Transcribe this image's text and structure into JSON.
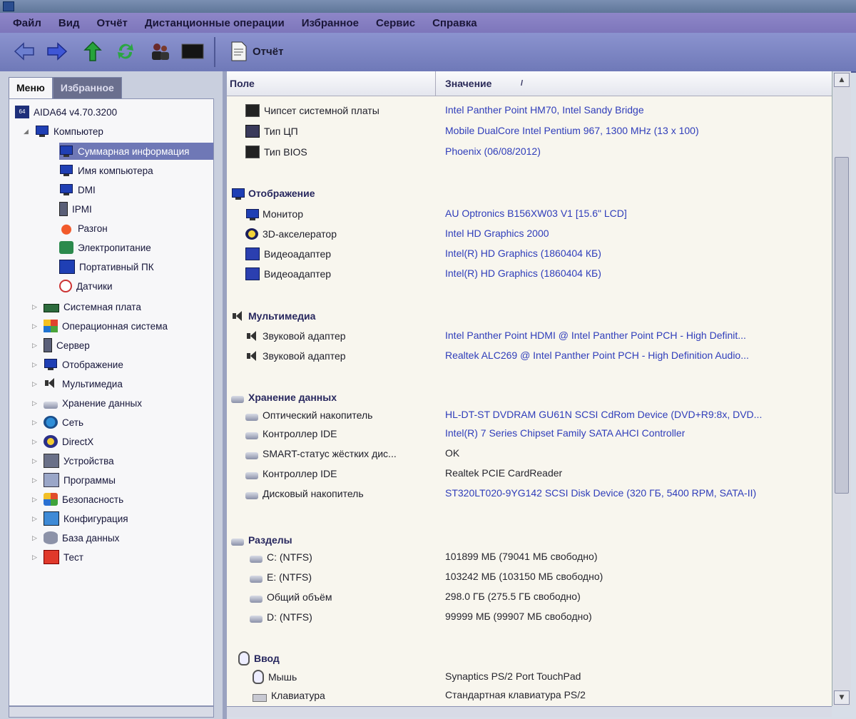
{
  "menu": [
    "Файл",
    "Вид",
    "Отчёт",
    "Дистанционные операции",
    "Избранное",
    "Сервис",
    "Справка"
  ],
  "toolbar": {
    "back_icon": "arrow-left-icon",
    "forward_icon": "arrow-right-icon",
    "up_icon": "arrow-up-icon",
    "refresh_icon": "refresh-icon",
    "users_icon": "users-icon",
    "report_label": "Отчёт"
  },
  "left_panel": {
    "tabs": [
      "Меню",
      "Избранное"
    ],
    "root": "AIDA64 v4.70.3200",
    "computer": "Компьютер",
    "computer_children": [
      "Суммарная информация",
      "Имя компьютера",
      "DMI",
      "IPMI",
      "Разгон",
      "Электропитание",
      "Портативный ПК",
      "Датчики"
    ],
    "categories": [
      "Системная плата",
      "Операционная система",
      "Сервер",
      "Отображение",
      "Мультимедиа",
      "Хранение данных",
      "Сеть",
      "DirectX",
      "Устройства",
      "Программы",
      "Безопасность",
      "Конфигурация",
      "База данных",
      "Тест"
    ]
  },
  "columns": {
    "field": "Поле",
    "value": "Значение"
  },
  "sections": {
    "motherboard_rows": [
      {
        "field": "Чипсет системной платы",
        "value": "Intel Panther Point HM70, Intel Sandy Bridge",
        "icon": "chip-icon"
      },
      {
        "field": "Тип ЦП",
        "value": "Mobile DualCore Intel Pentium 967, 1300 MHz (13 x 100)",
        "icon": "cpu-icon"
      },
      {
        "field": "Тип BIOS",
        "value": "Phoenix (06/08/2012)",
        "icon": "chip-icon"
      }
    ],
    "display": {
      "title": "Отображение",
      "rows": [
        {
          "field": "Монитор",
          "value": "AU Optronics B156XW03 V1  [15.6\" LCD]",
          "icon": "monitor-icon"
        },
        {
          "field": "3D-акселератор",
          "value": "Intel HD Graphics 2000",
          "icon": "directx-icon"
        },
        {
          "field": "Видеоадаптер",
          "value": "Intel(R) HD Graphics  (1860404 КБ)",
          "icon": "gpu-icon"
        },
        {
          "field": "Видеоадаптер",
          "value": "Intel(R) HD Graphics  (1860404 КБ)",
          "icon": "gpu-icon"
        }
      ]
    },
    "multimedia": {
      "title": "Мультимедиа",
      "rows": [
        {
          "field": "Звуковой адаптер",
          "value": "Intel Panther Point HDMI @ Intel Panther Point PCH - High Definit...",
          "icon": "speaker-icon"
        },
        {
          "field": "Звуковой адаптер",
          "value": "Realtek ALC269 @ Intel Panther Point PCH - High Definition Audio...",
          "icon": "speaker-icon"
        }
      ]
    },
    "storage": {
      "title": "Хранение данных",
      "rows": [
        {
          "field": "Оптический накопитель",
          "value": "HL-DT-ST DVDRAM GU61N SCSI CdRom Device  (DVD+R9:8x, DVD...",
          "link": true
        },
        {
          "field": "Контроллер IDE",
          "value": "Intel(R) 7 Series Chipset Family SATA AHCI Controller",
          "link": true
        },
        {
          "field": "SMART-статус жёстких дис...",
          "value": "OK",
          "link": false
        },
        {
          "field": "Контроллер IDE",
          "value": "Realtek PCIE CardReader",
          "link": false
        },
        {
          "field": "Дисковый накопитель",
          "value": "ST320LT020-9YG142 SCSI Disk Device  (320 ГБ, 5400 RPM, SATA-II)",
          "link": true
        }
      ]
    },
    "partitions": {
      "title": "Разделы",
      "rows": [
        {
          "field": "C: (NTFS)",
          "value": "101899 МБ (79041 МБ свободно)"
        },
        {
          "field": "E: (NTFS)",
          "value": "103242 МБ (103150 МБ свободно)"
        },
        {
          "field": "Общий объём",
          "value": "298.0 ГБ (275.5 ГБ свободно)"
        },
        {
          "field": "D: (NTFS)",
          "value": "99999 МБ (99907 МБ свободно)"
        }
      ]
    },
    "input": {
      "title": "Ввод",
      "rows": [
        {
          "field": "Мышь",
          "value": "Synaptics PS/2 Port TouchPad",
          "icon": "mouse-icon"
        },
        {
          "field": "Клавиатура",
          "value": "Стандартная клавиатура PS/2",
          "icon": "keyboard-icon"
        }
      ]
    }
  },
  "colors": {
    "menubar": "#8e86c8",
    "toolbar": "#7d86c4",
    "link": "#2f3dba",
    "selection": "#6f78b6"
  }
}
